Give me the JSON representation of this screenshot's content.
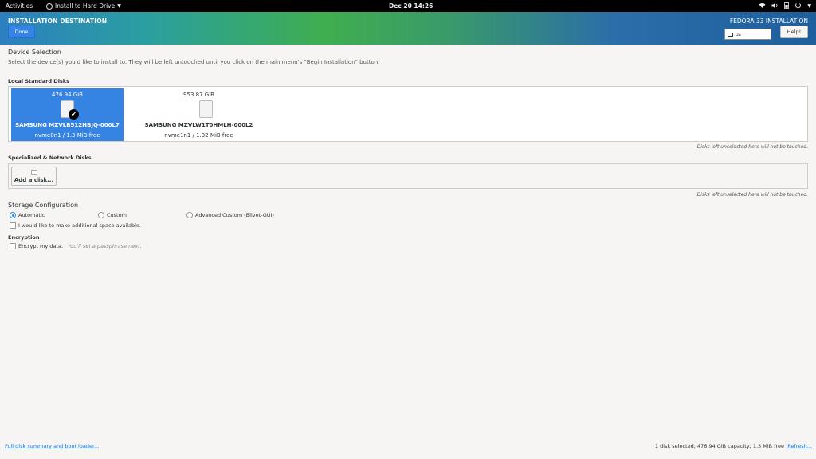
{
  "topbar": {
    "activities": "Activities",
    "app_name": "Install to Hard Drive",
    "clock": "Dec 20  14:26",
    "tray_icons": [
      "network-icon",
      "volume-icon",
      "battery-icon",
      "power-icon"
    ]
  },
  "header": {
    "title": "INSTALLATION DESTINATION",
    "product": "FEDORA 33 INSTALLATION",
    "done_label": "Done",
    "keyboard_layout": "us",
    "help_label": "Help!"
  },
  "device_selection": {
    "heading": "Device Selection",
    "description": "Select the device(s) you'd like to install to.  They will be left untouched until you click on the main menu's \"Begin Installation\" button."
  },
  "local_disks": {
    "heading": "Local Standard Disks",
    "disks": [
      {
        "size": "476.94 GiB",
        "model": "SAMSUNG MZVLB512HBJQ-000L7",
        "info": "nvme0n1    /    1.3 MiB free",
        "selected": true
      },
      {
        "size": "953.87 GiB",
        "model": "SAMSUNG MZVLW1T0HMLH-000L2",
        "info": "nvme1n1    /    1.32 MiB free",
        "selected": false
      }
    ],
    "note": "Disks left unselected here will not be touched."
  },
  "special_disks": {
    "heading": "Specialized & Network Disks",
    "add_label": "Add a disk...",
    "note": "Disks left unselected here will not be touched."
  },
  "storage": {
    "heading": "Storage Configuration",
    "options": [
      "Automatic",
      "Custom",
      "Advanced Custom (Blivet-GUI)"
    ],
    "selected": "Automatic",
    "extra_space_label": "I would like to make additional space available."
  },
  "encryption": {
    "heading": "Encryption",
    "encrypt_label": "Encrypt my data.",
    "encrypt_hint": "You'll set a passphrase next."
  },
  "footer": {
    "summary_link": "Full disk summary and boot loader...",
    "status": "1 disk selected; 476.94 GiB capacity; 1.3 MiB free",
    "refresh": "Refresh..."
  },
  "colors": {
    "accent": "#3584e4",
    "topbar": "#000000"
  }
}
